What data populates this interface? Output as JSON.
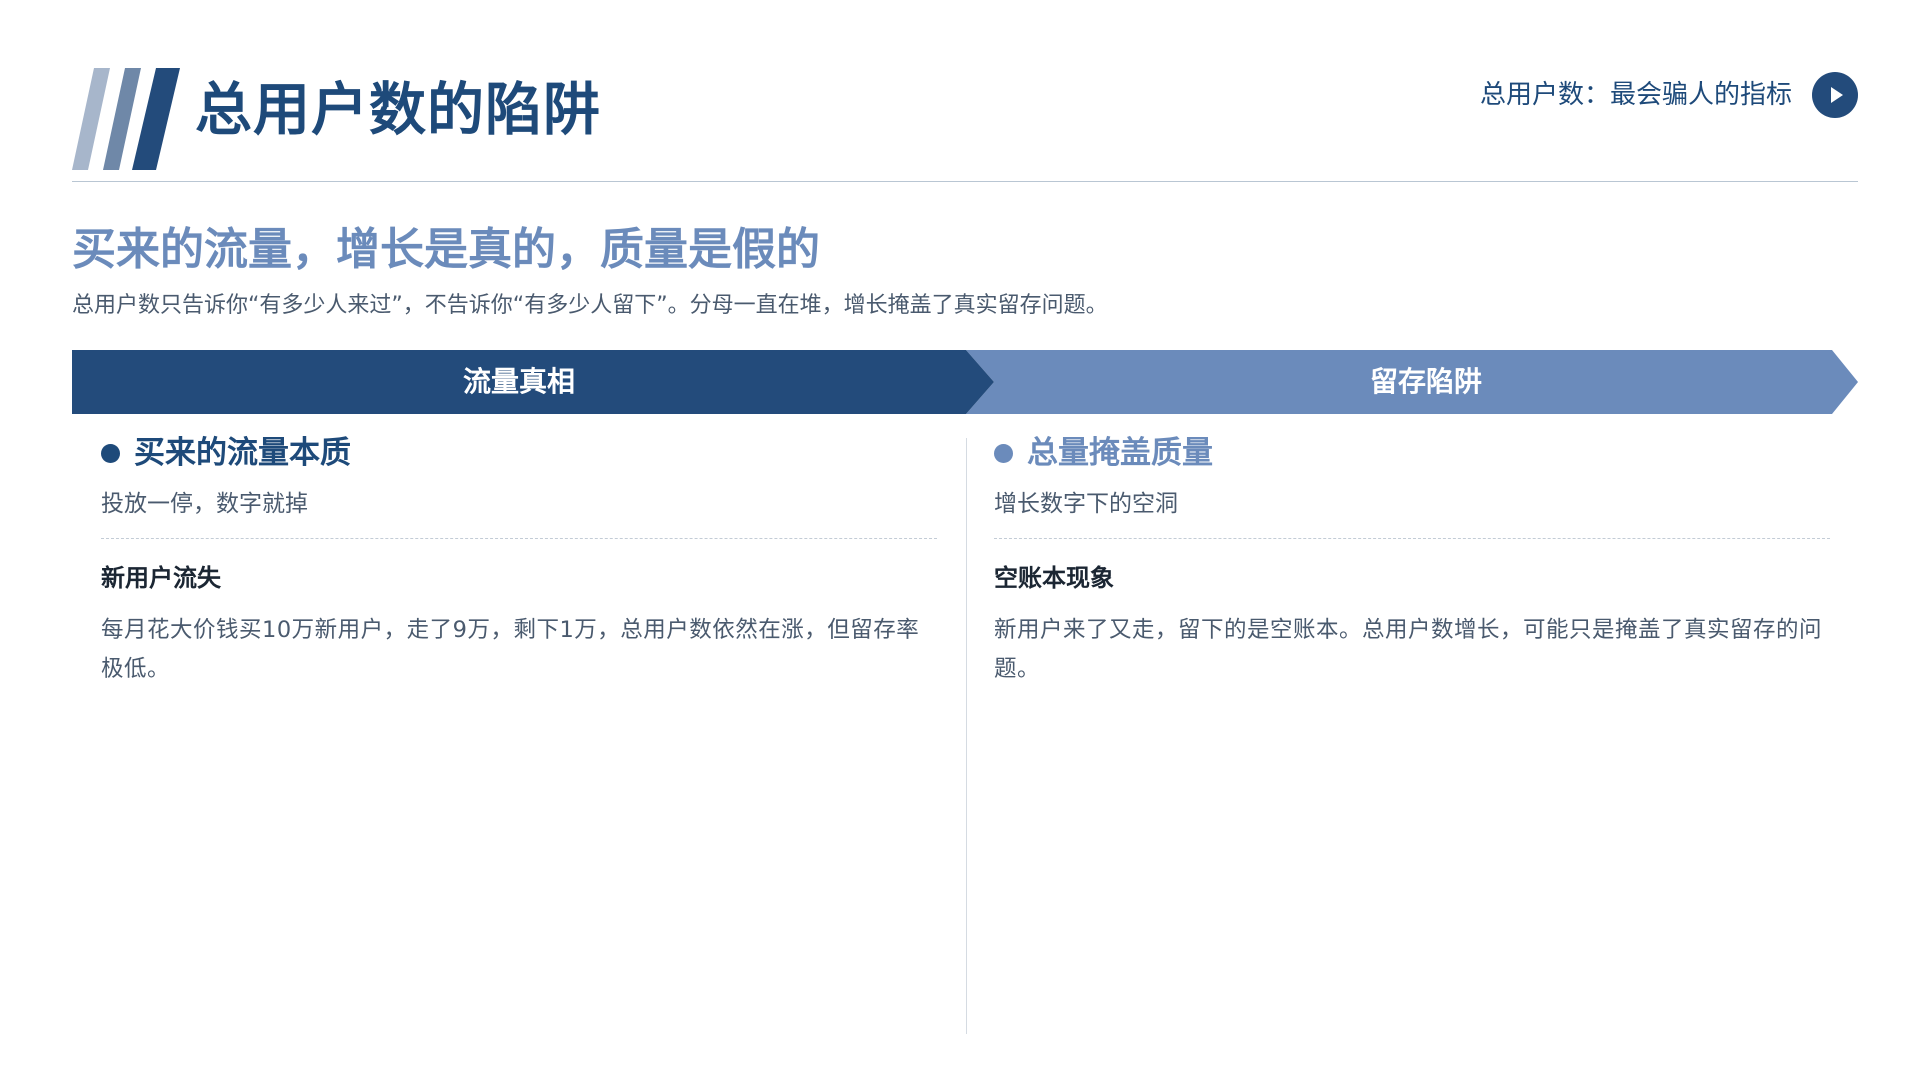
{
  "header": {
    "title": "总用户数的陷阱",
    "caption": "总用户数：最会骗人的指标",
    "logo_icon": "diagonal-stripes-icon",
    "play_icon": "play-icon",
    "stripe_colors": [
      "#a7b6cb",
      "#6f88a8",
      "#234b7b"
    ]
  },
  "headline": {
    "title": "买来的流量，增长是真的，质量是假的",
    "lead": "总用户数只告诉你“有多少人来过”，不告诉你“有多少人留下”。分母一直在堆，增长掩盖了真实留存问题。"
  },
  "banner": {
    "left_label": "流量真相",
    "right_label": "留存陷阱",
    "left_color": "#234b7b",
    "right_color": "#6b8bbb"
  },
  "columns": [
    {
      "title": "买来的流量本质",
      "subtitle": "投放一停，数字就掉",
      "point_title": "新用户流失",
      "point_body": "每月花大价钱买10万新用户，走了9万，剩下1万，总用户数依然在涨，但留存率极低。"
    },
    {
      "title": "总量掩盖质量",
      "subtitle": "增长数字下的空洞",
      "point_title": "空账本现象",
      "point_body": "新用户来了又走，留下的是空账本。总用户数增长，可能只是掩盖了真实留存的问题。"
    }
  ]
}
